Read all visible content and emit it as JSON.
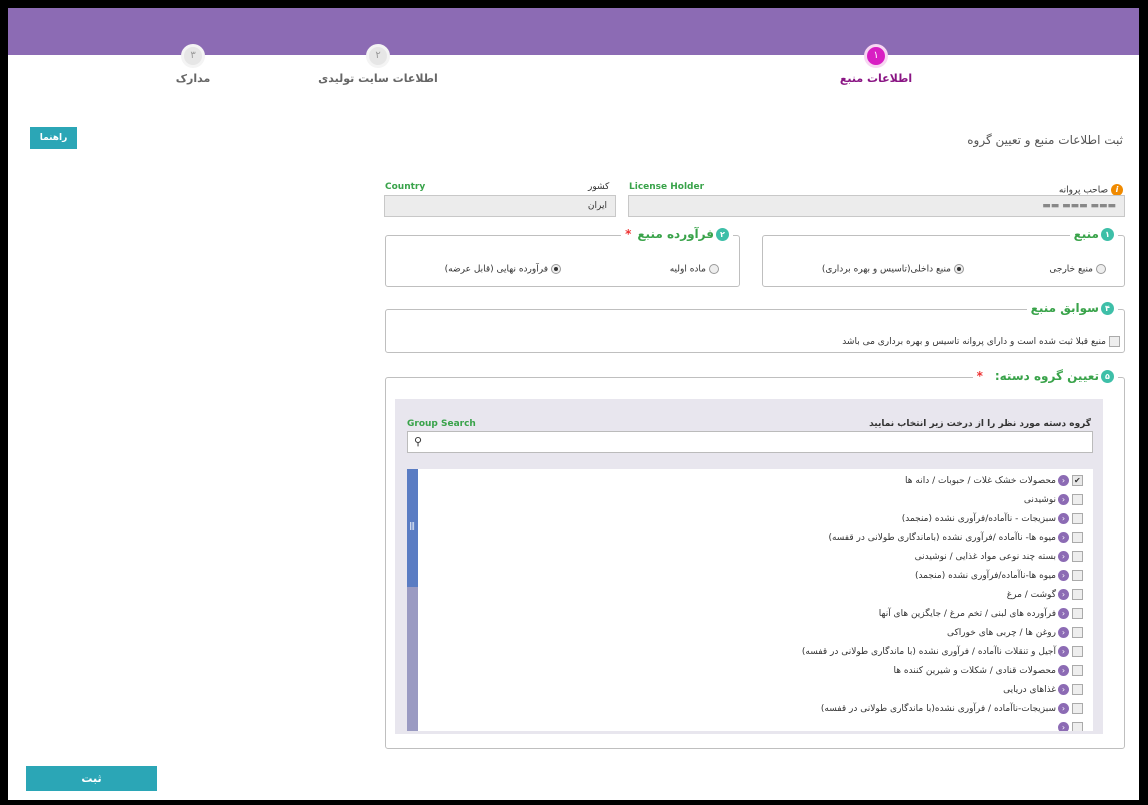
{
  "steps": [
    {
      "number": "۳",
      "label": "مدارک"
    },
    {
      "number": "۲",
      "label": "اطلاعات سایت تولیدی"
    },
    {
      "number": "۱",
      "label": "اطلاعات منبع"
    }
  ],
  "help_button": "راهنما",
  "page_title": "ثبت اطلاعات منبع و تعیین گروه",
  "license_holder": {
    "label_fa": "صاحب پروانه",
    "label_en": "License Holder",
    "value": "▬▬▬ ▬▬▬ ▬▬"
  },
  "country": {
    "label_fa": "کشور",
    "label_en": "Country",
    "value": "ایران"
  },
  "source": {
    "number": "۱",
    "legend": "منبع",
    "options": [
      "منبع خارجی",
      "منبع داخلی(تاسیس و بهره برداری)"
    ]
  },
  "product": {
    "number": "۲",
    "legend": "فرآورده منبع",
    "required": "*",
    "options": [
      "ماده اولیه",
      "فرآورده نهایی (قابل عرضه)"
    ]
  },
  "history": {
    "number": "۴",
    "legend": "سوابق منبع",
    "checkbox_label": "منبع قبلا ثبت شده است و دارای پروانه تاسیس و بهره برداری می باشد"
  },
  "group": {
    "number": "۵",
    "legend": "تعیین گروه دسته:",
    "required": "*",
    "instruction": "گروه دسته مورد نظر را از درخت زیر انتخاب نمایید",
    "search_label": "Group Search",
    "search_value": "",
    "items": [
      {
        "label": "محصولات خشک غلات / حبوبات / دانه ها",
        "checked": true
      },
      {
        "label": "نوشیدنی",
        "checked": false
      },
      {
        "label": "سبزیجات - ناآماده/فرآوری نشده (منجمد)",
        "checked": false
      },
      {
        "label": "میوه ها- ناآماده /فرآوری نشده (باماندگاری طولانی در قفسه)",
        "checked": false
      },
      {
        "label": "بسته چند نوعی مواد غذایی / نوشیدنی",
        "checked": false
      },
      {
        "label": "میوه ها-ناآماده/فرآوری نشده (منجمد)",
        "checked": false
      },
      {
        "label": "گوشت / مرغ",
        "checked": false
      },
      {
        "label": "فرآورده های لبنی / تخم مرغ / جایگزین های آنها",
        "checked": false
      },
      {
        "label": "روغن ها / چربی های خوراکی",
        "checked": false
      },
      {
        "label": "آجیل و تنقلات ناآماده / فرآوری نشده (با ماندگاری طولانی در قفسه)",
        "checked": false
      },
      {
        "label": "محصولات قنادی / شکلات و شیرین کننده ها",
        "checked": false
      },
      {
        "label": "غذاهای دریایی",
        "checked": false
      },
      {
        "label": "سبزیجات-ناآماده / فرآوری نشده(با ماندگاری طولانی در قفسه)",
        "checked": false
      },
      {
        "label": "",
        "checked": false
      }
    ]
  },
  "submit_button": "ثبت",
  "colors": {
    "header": "#8c6bb4",
    "accent": "#2ba6b6",
    "active_step": "#d81ec3",
    "legend_green": "#39a34a"
  }
}
